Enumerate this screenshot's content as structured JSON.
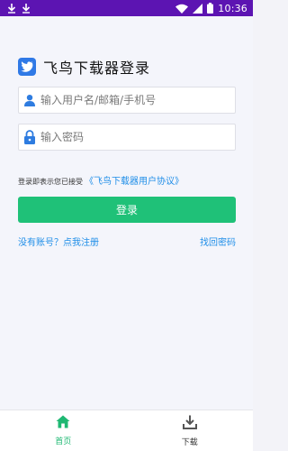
{
  "status_bar": {
    "time": "10:36",
    "bg_color": "#5c14b2",
    "left_icons": [
      "download-arrow-icon",
      "download-arrow-icon"
    ],
    "right_icons": [
      "wifi-icon",
      "signal-icon",
      "battery-icon"
    ]
  },
  "header": {
    "logo_icon": "bird-logo-icon",
    "title": "飞鸟下载器登录"
  },
  "form": {
    "username_placeholder": "输入用户名/邮箱/手机号",
    "username_value": "",
    "username_icon": "user-icon",
    "password_placeholder": "输入密码",
    "password_value": "",
    "password_icon": "lock-icon",
    "agreement_prefix": "登录即表示您已接受",
    "agreement_link": "《飞鸟下载器用户协议》",
    "login_label": "登录",
    "login_color": "#1fc178",
    "register_link": "没有账号？点我注册",
    "forgot_link": "找回密码",
    "link_color": "#1f8ee8"
  },
  "bottom_nav": {
    "items": [
      {
        "label": "首页",
        "icon": "home-icon",
        "active": true
      },
      {
        "label": "下载",
        "icon": "download-icon",
        "active": false
      }
    ],
    "active_color": "#1fb873"
  }
}
